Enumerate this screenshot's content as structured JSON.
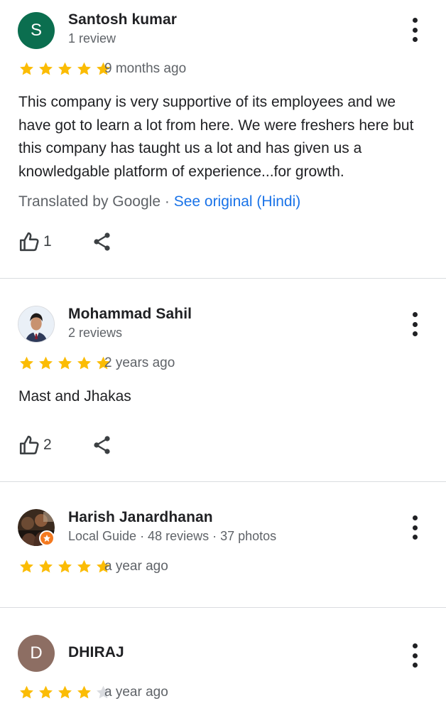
{
  "reviews": [
    {
      "avatar_letter": "S",
      "avatar_color": "#0b6e4f",
      "name": "Santosh kumar",
      "sub": "1 review",
      "rating": 5,
      "when": "9 months ago",
      "text": "This company is very supportive of its employees and we have got to learn a lot from here. We were freshers here but this company has taught us a lot and has given us a knowledgable platform of experience...for growth.",
      "translated_by": "Translated by Google",
      "see_original": "See original (Hindi)",
      "likes": "1"
    },
    {
      "avatar_icon": "person-photo-icon",
      "name": "Mohammad Sahil",
      "sub": "2 reviews",
      "rating": 5,
      "when": "2 years ago",
      "text": "Mast and Jhakas",
      "likes": "2"
    },
    {
      "avatar_icon": "group-photo-icon",
      "name": "Harish Janardhanan",
      "sub": "Local Guide · 48 reviews · 37 photos",
      "rating": 5,
      "when": "a year ago"
    },
    {
      "avatar_letter": "D",
      "avatar_color": "#8d6e63",
      "name": "DHIRAJ",
      "rating": 4,
      "when": "a year ago"
    }
  ],
  "colors": {
    "star_filled": "#fbbc04",
    "star_empty": "#dadce0",
    "link": "#1a73e8",
    "local_guide_badge": "#f4791f"
  },
  "separator": " · "
}
